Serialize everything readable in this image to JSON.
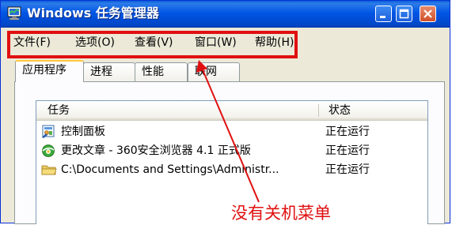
{
  "window": {
    "title": "Windows 任务管理器"
  },
  "titlebar_buttons": {
    "minimize": "minimize-icon",
    "maximize": "maximize-icon",
    "close": "close-icon"
  },
  "menu": {
    "items": [
      {
        "label": "文件(F)"
      },
      {
        "label": "选项(O)"
      },
      {
        "label": "查看(V)"
      },
      {
        "label": "窗口(W)"
      },
      {
        "label": "帮助(H)"
      }
    ]
  },
  "tabs": [
    {
      "label": "应用程序",
      "active": true
    },
    {
      "label": "进程",
      "active": false
    },
    {
      "label": "性能",
      "active": false
    },
    {
      "label": "联网",
      "active": false
    }
  ],
  "list": {
    "columns": {
      "task": "任务",
      "status": "状态"
    },
    "rows": [
      {
        "task": "控制面板",
        "status": "正在运行",
        "icon": "control-panel-icon"
      },
      {
        "task": "更改文章 - 360安全浏览器 4.1 正式版",
        "status": "正在运行",
        "icon": "browser-360-icon"
      },
      {
        "task": "C:\\Documents and Settings\\Administr...",
        "status": "正在运行",
        "icon": "folder-icon"
      }
    ]
  },
  "annotation": {
    "text": "没有关机菜单",
    "color": "#e01010"
  }
}
